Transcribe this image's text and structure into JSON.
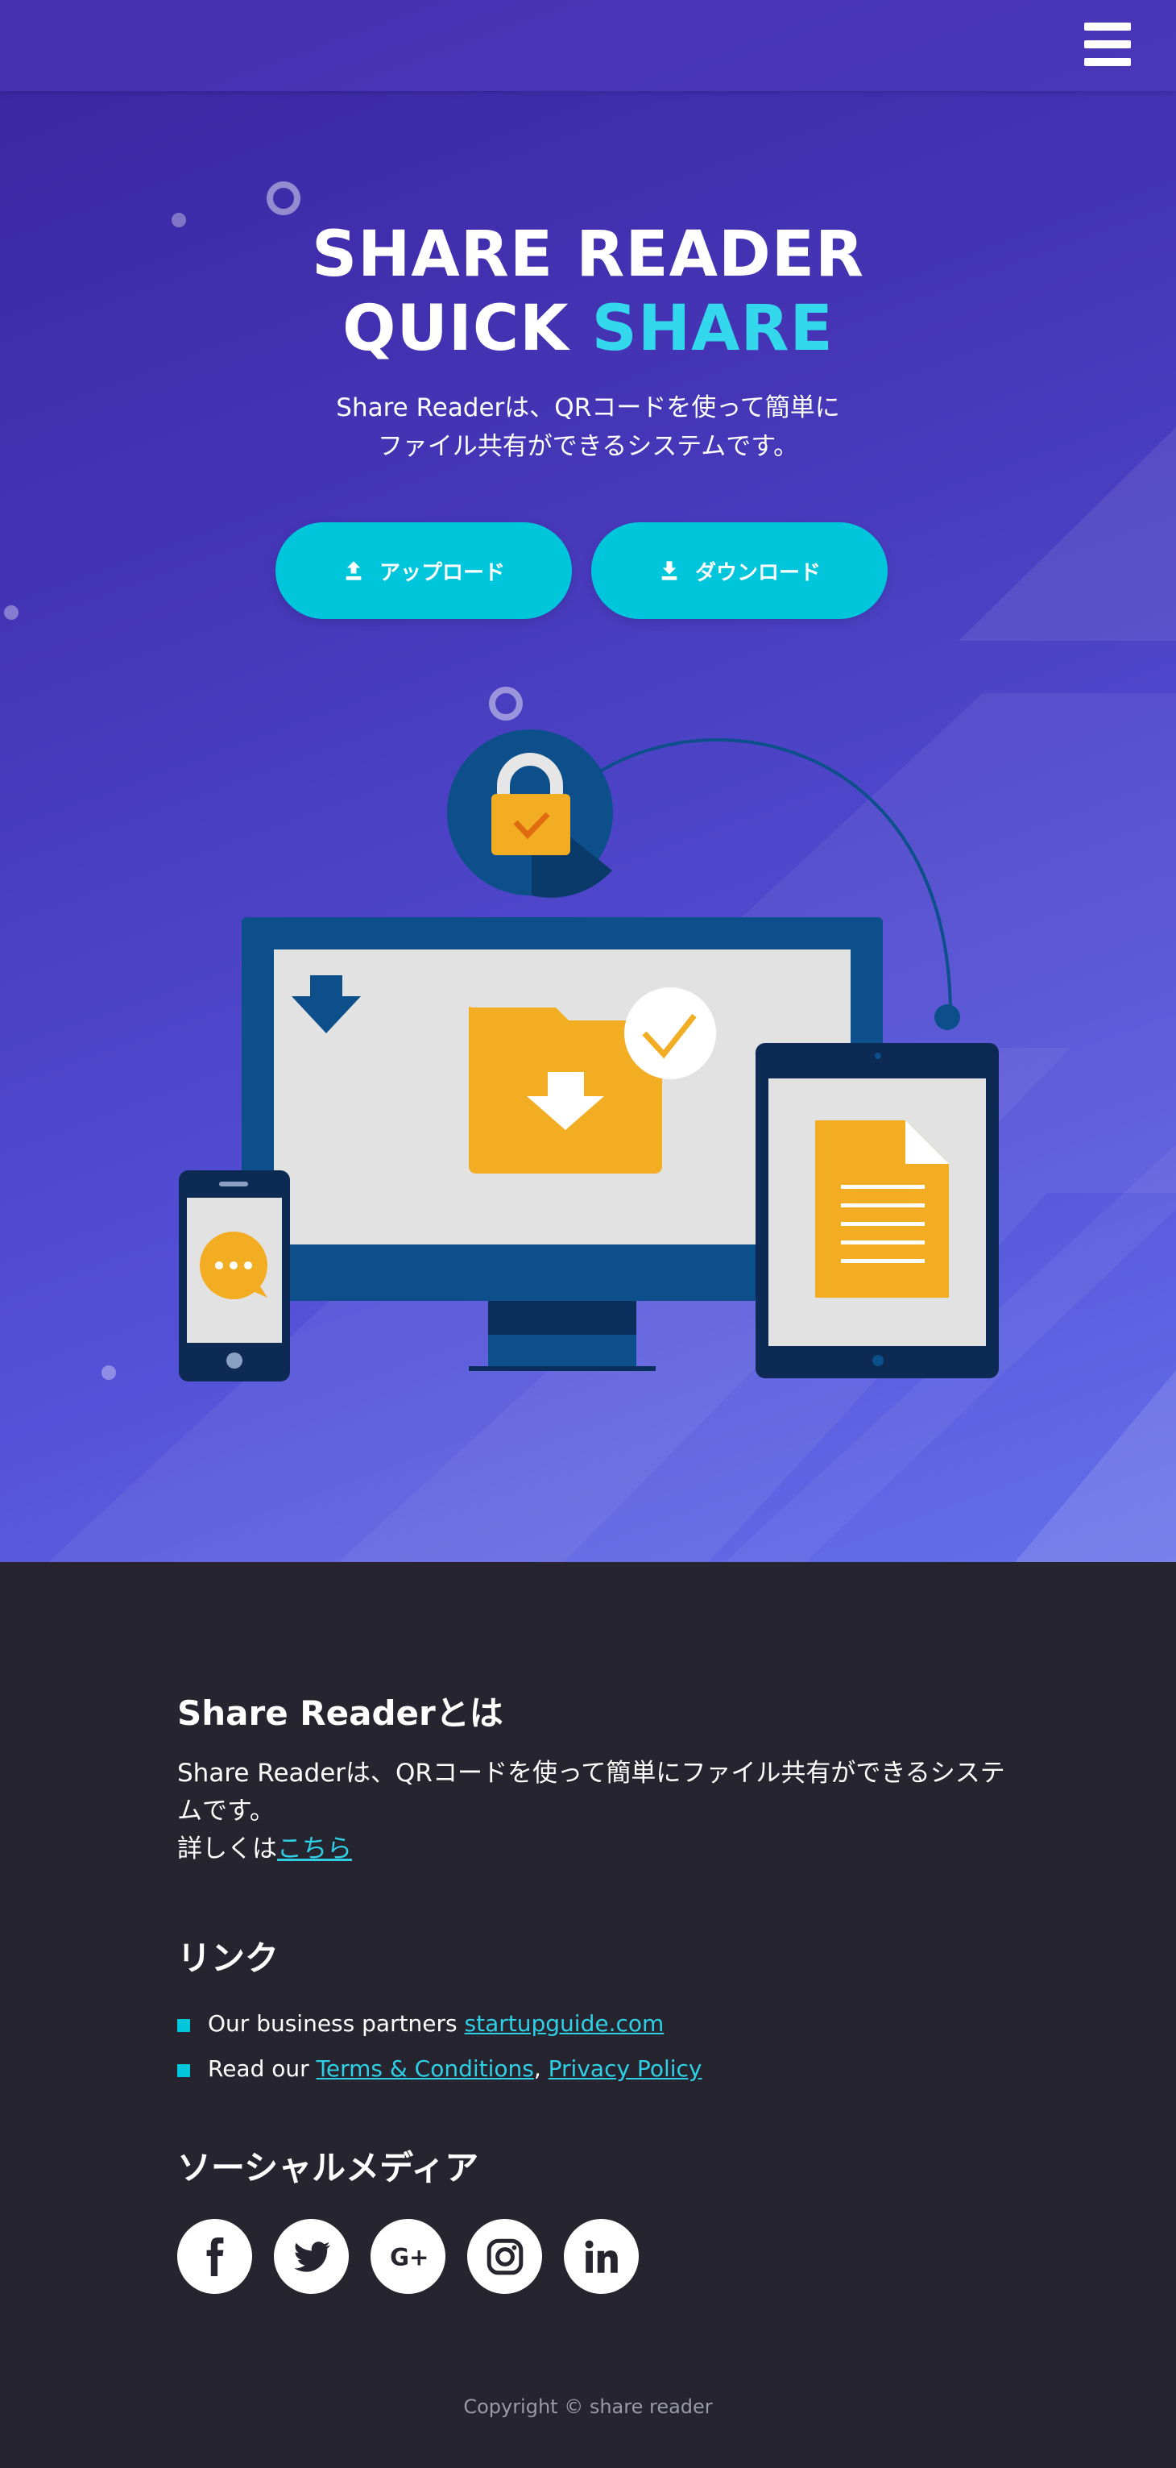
{
  "hero": {
    "title_line1": "SHARE READER",
    "title_line2_a": "QUICK",
    "title_line2_b": "SHARE",
    "subtitle_line1": "Share Readerは、QRコードを使って簡単に",
    "subtitle_line2": "ファイル共有ができるシステムです。",
    "upload_label": "アップロード",
    "download_label": "ダウンロード"
  },
  "about": {
    "heading": "Share Readerとは",
    "text": "Share Readerは、QRコードを使って簡単にファイル共有ができるシステムです。",
    "more_prefix": "詳しくは",
    "more_link": "こちら"
  },
  "links": {
    "heading": "リンク",
    "item1_prefix": "Our business partners ",
    "item1_link": "startupguide.com",
    "item2_prefix": "Read our ",
    "item2_link1": "Terms & Conditions",
    "item2_sep": ", ",
    "item2_link2": "Privacy Policy"
  },
  "social": {
    "heading": "ソーシャルメディア",
    "icons": [
      "facebook-icon",
      "twitter-icon",
      "google-plus-icon",
      "instagram-icon",
      "linkedin-icon"
    ]
  },
  "copyright": "Copyright © share reader",
  "colors": {
    "accent": "#00c6dc",
    "accent_text": "#34d8ec",
    "footer_bg": "#26252f",
    "hero_start": "#3a24a0",
    "hero_end": "#6470ea",
    "folder": "#f2ad22",
    "device_dark": "#0d2a55",
    "device_blue": "#0d4f8b"
  }
}
